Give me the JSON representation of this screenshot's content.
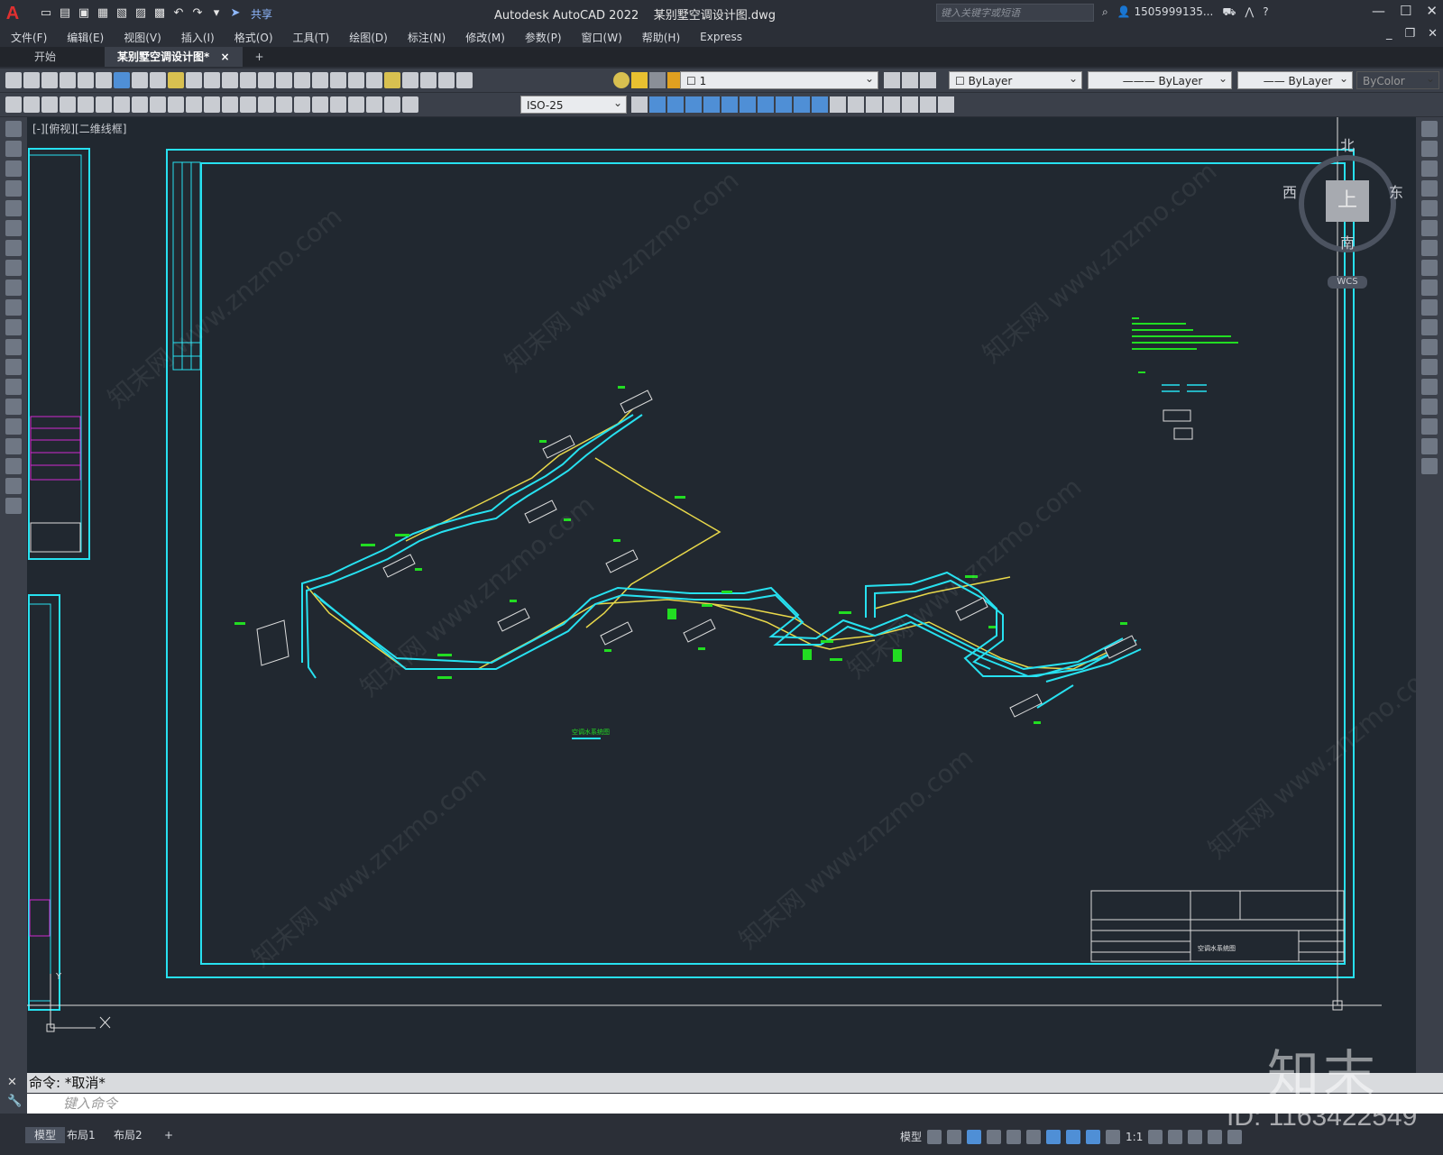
{
  "app": {
    "logo": "A",
    "title": "Autodesk AutoCAD 2022",
    "file": "某别墅空调设计图.dwg",
    "share_label": "共享",
    "search_placeholder": "键入关键字或短语",
    "user": "1505999135...",
    "help": "?"
  },
  "menu": [
    "文件(F)",
    "编辑(E)",
    "视图(V)",
    "插入(I)",
    "格式(O)",
    "工具(T)",
    "绘图(D)",
    "标注(N)",
    "修改(M)",
    "参数(P)",
    "窗口(W)",
    "帮助(H)",
    "Express"
  ],
  "tabs": {
    "start": "开始",
    "drawing": "某别墅空调设计图*",
    "close": "×",
    "add": "+"
  },
  "toolbar": {
    "layer": "1",
    "color": "ByLayer",
    "linetype": "ByLayer",
    "lineweight": "ByLayer",
    "plotstyle": "ByColor",
    "dimstyle": "ISO-25"
  },
  "viewport": {
    "label": "[-][俯视][二维线框]",
    "north": "北",
    "south": "南",
    "east": "东",
    "west": "西",
    "top": "上",
    "wcs": "WCS",
    "axis_y": "Y"
  },
  "drawing": {
    "caption": "空调水系统图",
    "title_block_name": "空调水系统图"
  },
  "command": {
    "history": "命令: *取消*",
    "placeholder": "键入命令"
  },
  "layout_tabs": [
    "模型",
    "布局1",
    "布局2"
  ],
  "layout_add": "+",
  "status": {
    "model": "模型",
    "scale": "1:1"
  },
  "watermark": {
    "logo": "知末",
    "id": "ID: 1163422549",
    "site": "知末网 www.znzmo.com"
  },
  "colors": {
    "cyan": "#27e1f0",
    "yellow": "#e8d84a",
    "green": "#22dd22",
    "magenta": "#d02ad0",
    "canvas": "#212830"
  }
}
